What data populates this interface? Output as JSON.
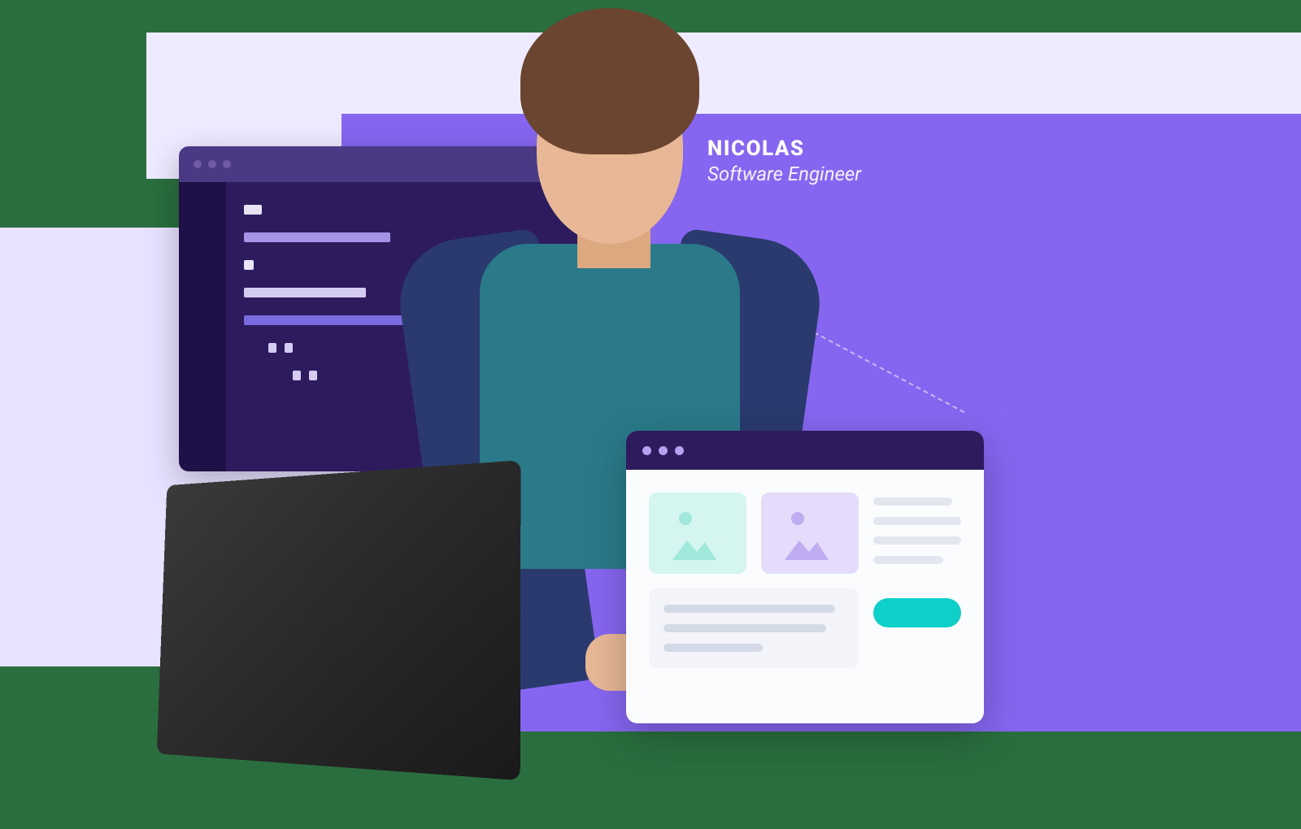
{
  "label": {
    "name": "NICOLAS",
    "role": "Software Engineer"
  },
  "colors": {
    "accent_purple": "#8666f0",
    "dark_purple": "#2d1b5e",
    "lavender": "#e8e1ff",
    "teal_cta": "#0fd0c8"
  }
}
